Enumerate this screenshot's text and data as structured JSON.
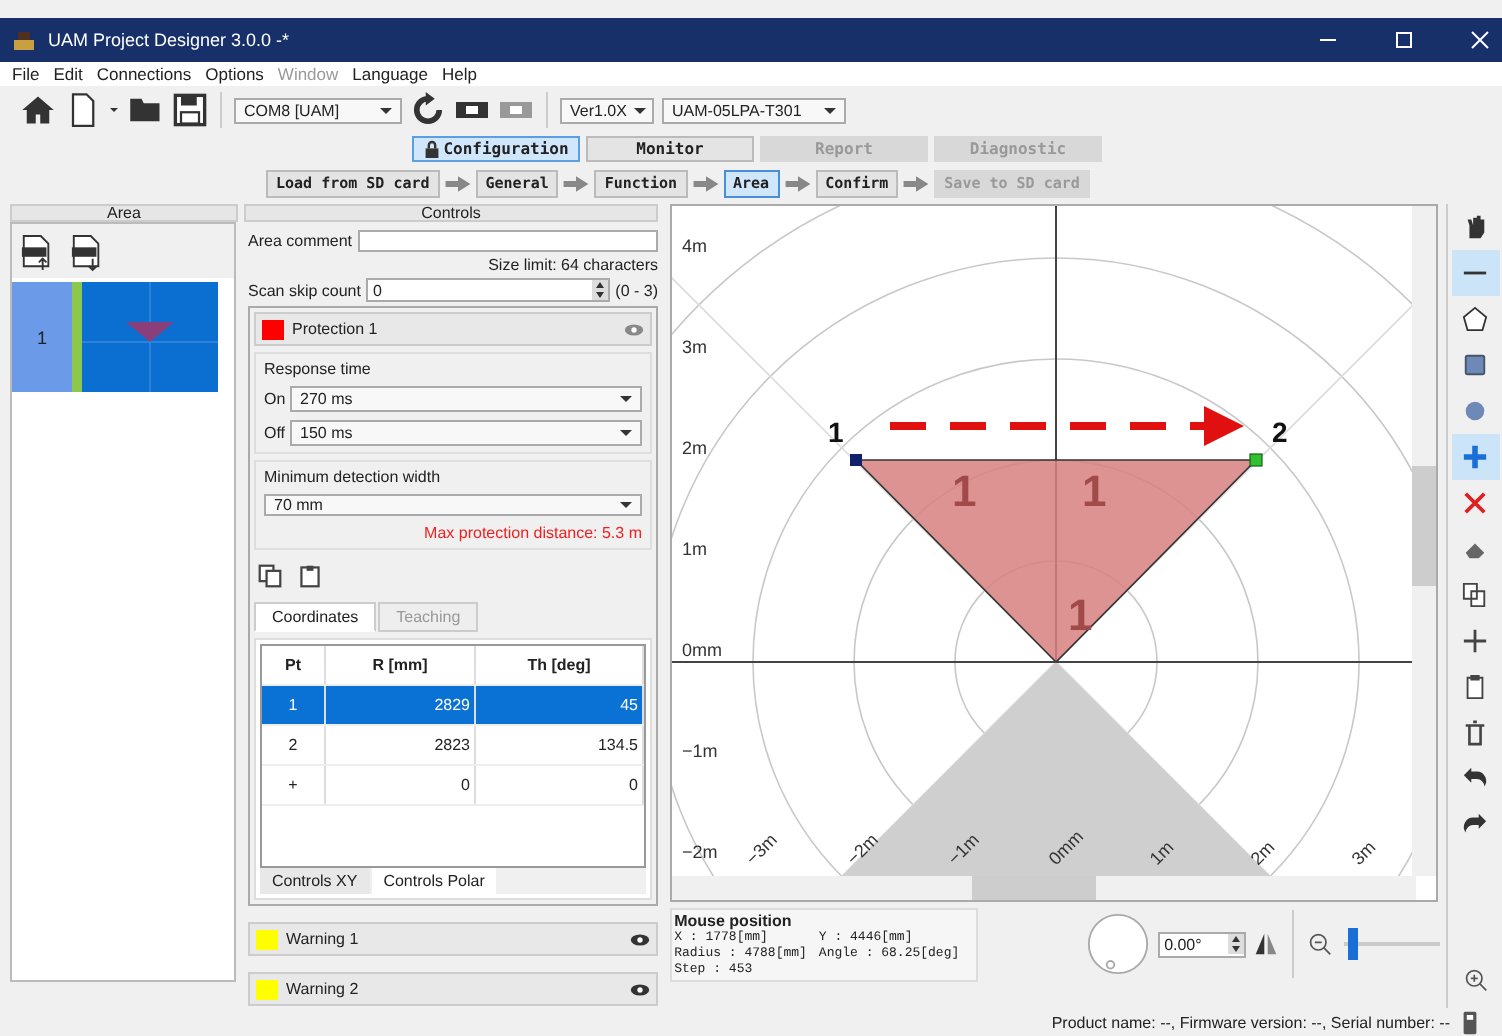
{
  "window": {
    "title": "UAM Project Designer 3.0.0 -*"
  },
  "menu": [
    {
      "label": "File",
      "disabled": false
    },
    {
      "label": "Edit",
      "disabled": false
    },
    {
      "label": "Connections",
      "disabled": false
    },
    {
      "label": "Options",
      "disabled": false
    },
    {
      "label": "Window",
      "disabled": true
    },
    {
      "label": "Language",
      "disabled": false
    },
    {
      "label": "Help",
      "disabled": false
    }
  ],
  "toolbar": {
    "port": "COM8 [UAM]",
    "version": "Ver1.0X",
    "model": "UAM-05LPA-T301"
  },
  "mode_tabs": [
    {
      "label": "Configuration",
      "selected": true,
      "disabled": false
    },
    {
      "label": "Monitor",
      "selected": false,
      "disabled": false
    },
    {
      "label": "Report",
      "selected": false,
      "disabled": true
    },
    {
      "label": "Diagnostic",
      "selected": false,
      "disabled": true
    }
  ],
  "steps": [
    {
      "label": "Load from SD card",
      "selected": false,
      "disabled": false
    },
    {
      "label": "General",
      "selected": false,
      "disabled": false
    },
    {
      "label": "Function",
      "selected": false,
      "disabled": false
    },
    {
      "label": "Area",
      "selected": true,
      "disabled": false
    },
    {
      "label": "Confirm",
      "selected": false,
      "disabled": false
    },
    {
      "label": "Save to SD card",
      "selected": false,
      "disabled": true
    }
  ],
  "panel_headers": [
    "Area",
    "Controls"
  ],
  "areas": [
    {
      "number": "1",
      "selected": true
    }
  ],
  "controls": {
    "area_comment_label": "Area comment",
    "size_limit": "Size limit: 64 characters",
    "scan_skip_label": "Scan skip count",
    "scan_skip_value": "0",
    "scan_skip_range": "(0 - 3)",
    "protection": {
      "name": "Protection 1",
      "color": "#ff0000"
    },
    "response_time_title": "Response time",
    "on_label": "On",
    "on_value": "270 ms",
    "off_label": "Off",
    "off_value": "150 ms",
    "min_width_title": "Minimum detection width",
    "min_width_value": "70 mm",
    "max_distance": "Max protection distance: 5.3 m",
    "table_tabs": [
      {
        "label": "Coordinates",
        "selected": true
      },
      {
        "label": "Teaching",
        "selected": false
      }
    ],
    "columns": [
      "Pt",
      "R [mm]",
      "Th [deg]"
    ],
    "rows": [
      {
        "cells": [
          "1",
          "2829",
          "45"
        ],
        "selected": true
      },
      {
        "cells": [
          "2",
          "2823",
          "134.5"
        ],
        "selected": false
      },
      {
        "cells": [
          "+",
          "0",
          "0"
        ],
        "selected": false
      }
    ],
    "mode_tabs": [
      {
        "label": "Controls XY",
        "selected": false
      },
      {
        "label": "Controls Polar",
        "selected": true
      }
    ],
    "warnings": [
      {
        "name": "Warning 1",
        "color": "#ffff00"
      },
      {
        "name": "Warning 2",
        "color": "#ffff00"
      }
    ]
  },
  "canvas": {
    "y_labels": [
      "4m",
      "3m",
      "2m",
      "1m",
      "0mm",
      "−1m",
      "−2m"
    ],
    "x_labels": [
      "−3m",
      "−2m",
      "−1m",
      "0mm",
      "1m",
      "2m",
      "3m"
    ],
    "point_labels": [
      "1",
      "2"
    ],
    "zone_labels": [
      "1",
      "1",
      "1"
    ]
  },
  "tools": [
    {
      "kind": "hand",
      "selected": false
    },
    {
      "kind": "line",
      "selected": true
    },
    {
      "kind": "polygon",
      "selected": false
    },
    {
      "kind": "rectangle",
      "selected": false
    },
    {
      "kind": "circle",
      "selected": false
    },
    {
      "kind": "add",
      "selected": true
    },
    {
      "kind": "remove",
      "selected": false
    },
    {
      "kind": "fill",
      "selected": false
    },
    {
      "kind": "copy",
      "selected": false
    },
    {
      "kind": "move",
      "selected": false
    },
    {
      "kind": "paste",
      "selected": false
    },
    {
      "kind": "trash",
      "selected": false
    },
    {
      "kind": "undo",
      "selected": false
    },
    {
      "kind": "redo",
      "selected": false
    }
  ],
  "mouse_position": {
    "title": "Mouse position",
    "x": "X : 1778[mm]",
    "y": "Y : 4446[mm]",
    "radius": "Radius : 4788[mm]",
    "angle": "Angle : 68.25[deg]",
    "step": "Step : 453"
  },
  "rotation": "0.00°",
  "zoom": {
    "level": 0.05
  },
  "status": "Product name: --, Firmware version: --, Serial number: --"
}
